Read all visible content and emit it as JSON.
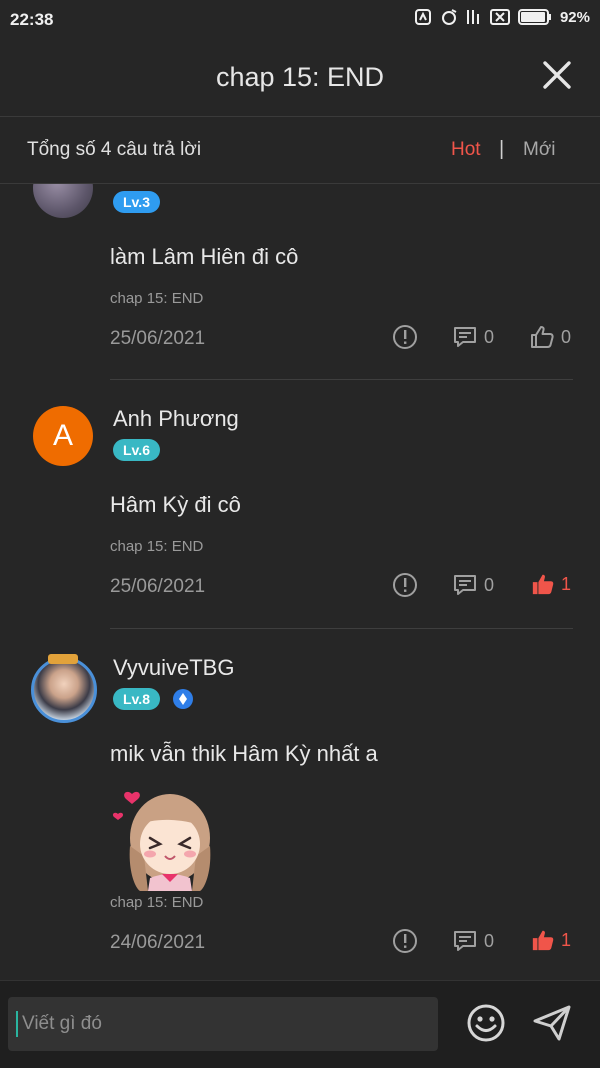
{
  "status_bar": {
    "time": "22:38",
    "battery": "92%",
    "icons": [
      "sim-icon",
      "alarm-icon",
      "signal-icon",
      "no-sim-icon",
      "battery-icon"
    ]
  },
  "header": {
    "title": "chap 15: END",
    "close_icon": "close-icon"
  },
  "sort_bar": {
    "count_text": "Tổng số 4 câu trả lời",
    "hot_label": "Hot",
    "separator": "|",
    "new_label": "Mới"
  },
  "colors": {
    "accent": "#f0554a",
    "background": "#262626",
    "level_blue": "#2f9cf0",
    "level_teal": "#39b8c4",
    "avatar_orange": "#ef6c00"
  },
  "comments": [
    {
      "user": "",
      "level": "Lv.3",
      "text": "làm Lâm Hiên đi cô",
      "chapter": "chap 15: END",
      "date": "25/06/2021",
      "replies": "0",
      "likes": "0",
      "liked": false
    },
    {
      "user": "Anh Phương",
      "avatar_letter": "A",
      "level": "Lv.6",
      "text": "Hâm Kỳ đi cô",
      "chapter": "chap 15: END",
      "date": "25/06/2021",
      "replies": "0",
      "likes": "1",
      "liked": true
    },
    {
      "user": "VyvuiveTBG",
      "level": "Lv.8",
      "text": "mik vẫn thik Hâm Kỳ nhất a",
      "chapter": "chap 15: END",
      "date": "24/06/2021",
      "replies": "0",
      "likes": "1",
      "liked": true
    }
  ],
  "composer": {
    "placeholder": "Viết gì đó",
    "emoji_icon": "emoji-icon",
    "send_icon": "send-icon"
  }
}
